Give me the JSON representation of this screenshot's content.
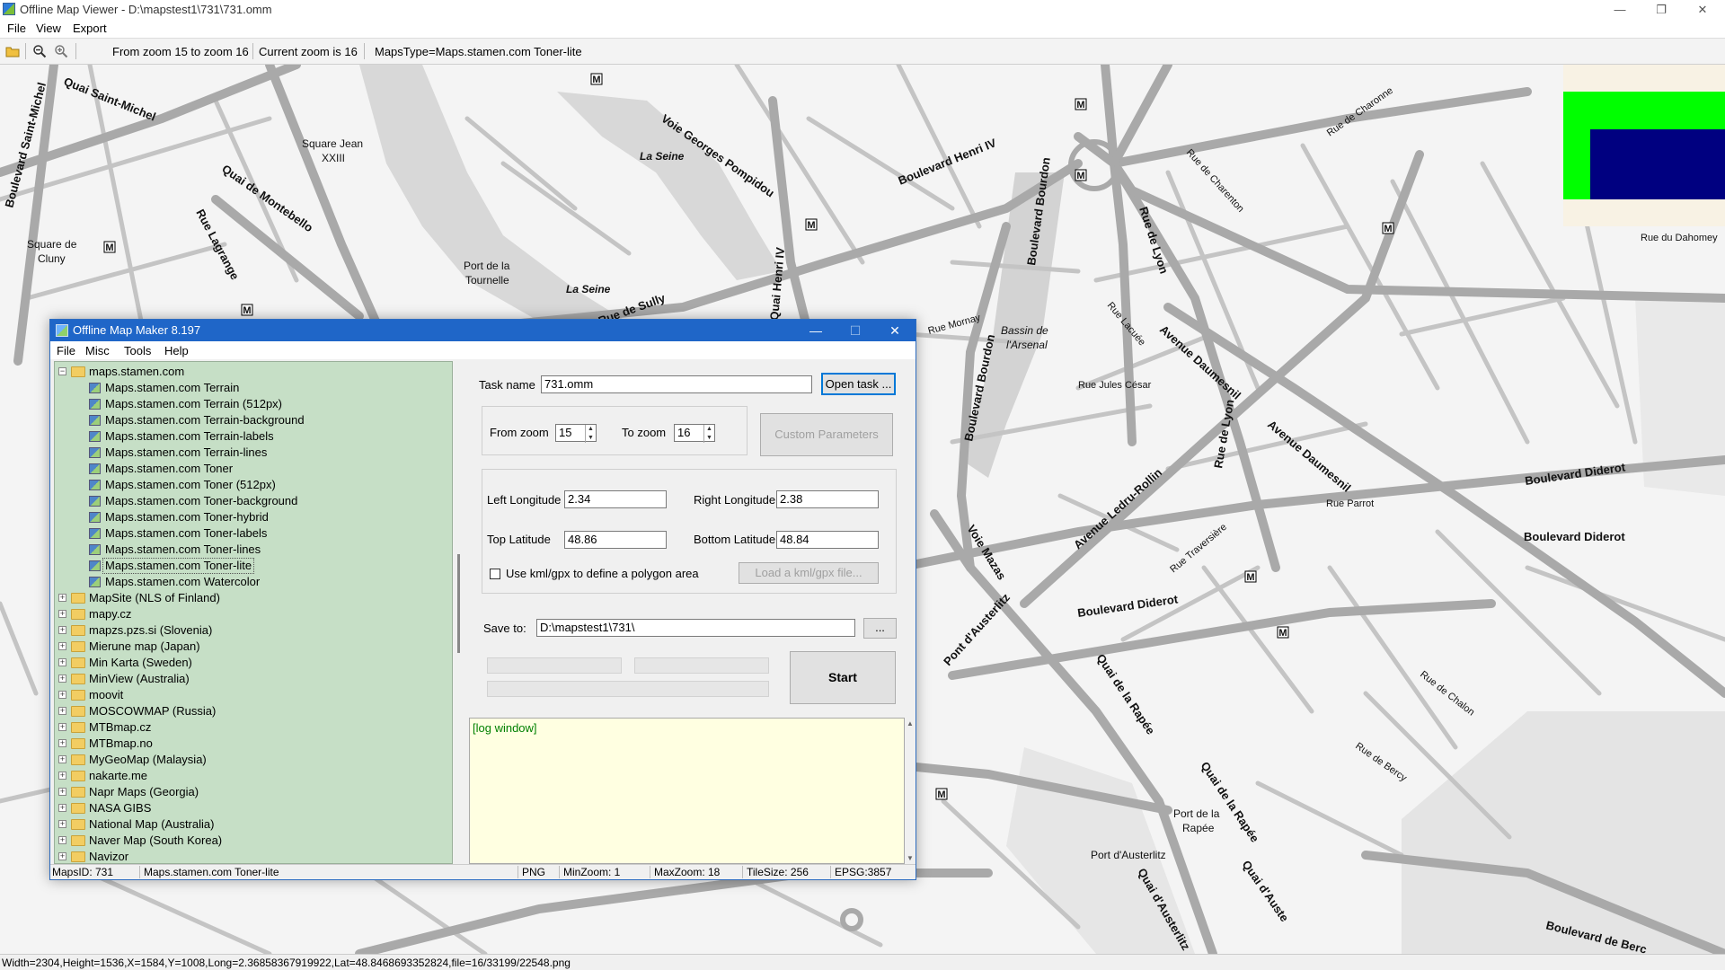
{
  "window": {
    "title": "Offline Map Viewer - D:\\mapstest1\\731\\731.omm",
    "menu": [
      "File",
      "View",
      "Export"
    ],
    "controls": {
      "minimize": "—",
      "maximize": "❐",
      "close": "✕"
    }
  },
  "toolbar": {
    "zoom_range": "From zoom 15 to zoom 16",
    "current_zoom": "Current zoom is 16",
    "maps_type": "MapsType=Maps.stamen.com Toner-lite"
  },
  "statusbar": {
    "text": "Width=2304,Height=1536,X=1584,Y=1008,Long=2.36858367919922,Lat=48.8468693352824,file=16/33199/22548.png"
  },
  "map_labels": {
    "quai_saint_michel": "Quai Saint-Michel",
    "boulevard_saint_michel": "Boulevard Saint-Michel",
    "square_jean": "Square Jean",
    "xxiii": "XXIII",
    "quai_montebello": "Quai de Montebello",
    "rue_lagrange": "Rue Lagrange",
    "square_cluny1": "Square de",
    "square_cluny2": "Cluny",
    "la_seine1": "La Seine",
    "la_seine2": "La Seine",
    "voie_pompidou": "Voie Georges Pompidou",
    "quai_henri": "Quai Henri IV",
    "port_tournelle1": "Port de la",
    "port_tournelle2": "Tournelle",
    "rue_sully": "Rue de Sully",
    "bd_henri": "Boulevard Henri IV",
    "bd_bourdon": "Boulevard Bourdon",
    "rue_de_lyon": "Rue de Lyon",
    "bassin1": "Bassin de",
    "bassin2": "l'Arsenal",
    "avenue_daumesnil": "Avenue Daumesnil",
    "avenue_ledru": "Avenue Ledru-Rollin",
    "bd_diderot": "Boulevard Diderot",
    "bd_diderot2": "Boulevard Diderot",
    "bd_diderot3": "Boulevard Diderot",
    "voie_mazas": "Voie Mazas",
    "pont_austerlitz": "Pont d'Austerlitz",
    "quai_rapee": "Quai de la Rapée",
    "quai_rapee2": "Quai de la Rapée",
    "port_rapee1": "Port de la",
    "port_rapee2": "Rapée",
    "port_austerlitz": "Port d'Austerlitz",
    "quai_austerlitz": "Quai d'Austerlitz",
    "quai_austerlitz2": "Quai d'Auste",
    "rue_jules_cesar": "Rue Jules César",
    "bd_berc": "Boulevard de Berc",
    "rue_charenton": "Rue de Charenton",
    "rue_dahomey": "Rue du Dahomey",
    "rue_charonne": "Rue de Charonne",
    "rue_chalon": "Rue de Chalon",
    "rue_bercy": "Rue de Bercy",
    "rue_mornay": "Rue Mornay",
    "rue_traversiere": "Rue Traversière",
    "rue_lacuee": "Rue Lacuée",
    "rue_parrot": "Rue Parrot",
    "metro": "M"
  },
  "dialog": {
    "title": "Offline Map Maker 8.197",
    "menu": [
      "File",
      "Misc",
      "Tools",
      "Help"
    ],
    "controls": {
      "minimize": "—",
      "maximize": "☐",
      "close": "✕"
    },
    "tree": {
      "root": "maps.stamen.com",
      "children": [
        "Maps.stamen.com Terrain",
        "Maps.stamen.com Terrain (512px)",
        "Maps.stamen.com Terrain-background",
        "Maps.stamen.com Terrain-labels",
        "Maps.stamen.com Terrain-lines",
        "Maps.stamen.com Toner",
        "Maps.stamen.com Toner (512px)",
        "Maps.stamen.com Toner-background",
        "Maps.stamen.com Toner-hybrid",
        "Maps.stamen.com Toner-labels",
        "Maps.stamen.com Toner-lines",
        "Maps.stamen.com Toner-lite",
        "Maps.stamen.com Watercolor"
      ],
      "selected_index": 11,
      "folders": [
        "MapSite (NLS of Finland)",
        "mapy.cz",
        "mapzs.pzs.si (Slovenia)",
        "Mierune map (Japan)",
        "Min Karta (Sweden)",
        "MinView (Australia)",
        "moovit",
        "MOSCOWMAP (Russia)",
        "MTBmap.cz",
        "MTBmap.no",
        "MyGeoMap (Malaysia)",
        "nakarte.me",
        "Napr Maps (Georgia)",
        "NASA GIBS",
        "National Map (Australia)",
        "Naver Map (South Korea)",
        "Navizor"
      ]
    },
    "task_label": "Task name",
    "task_value": "731.omm",
    "open_task": "Open task ...",
    "from_zoom_label": "From zoom",
    "from_zoom": "15",
    "to_zoom_label": "To zoom",
    "to_zoom": "16",
    "custom_params": "Custom Parameters",
    "left_lon_label": "Left Longitude",
    "left_lon": "2.34",
    "right_lon_label": "Right Longitude",
    "right_lon": "2.38",
    "top_lat_label": "Top Latitude",
    "top_lat": "48.86",
    "bottom_lat_label": "Bottom Latitude",
    "bottom_lat": "48.84",
    "kml_label": "Use kml/gpx to define a polygon area",
    "kml_checked": false,
    "load_kml": "Load a kml/gpx file...",
    "save_label": "Save to:",
    "save_value": "D:\\mapstest1\\731\\",
    "browse": "...",
    "start": "Start",
    "log": "[log window]",
    "status": {
      "maps_id": "MapsID: 731",
      "map_name": "Maps.stamen.com Toner-lite",
      "format": "PNG",
      "min_zoom": "MinZoom: 1",
      "max_zoom": "MaxZoom: 18",
      "tile_size": "TileSize: 256",
      "epsg": "EPSG:3857"
    }
  },
  "colors": {
    "map_bg": "#f4f4f4",
    "road": "#a9a9a9",
    "river": "#d7d7d7",
    "tree_bg": "#c6dfc6",
    "log_bg": "#ffffe1",
    "dialog_title": "#1f66c8",
    "overview_green": "#00ff00",
    "overview_blue": "#000080"
  }
}
